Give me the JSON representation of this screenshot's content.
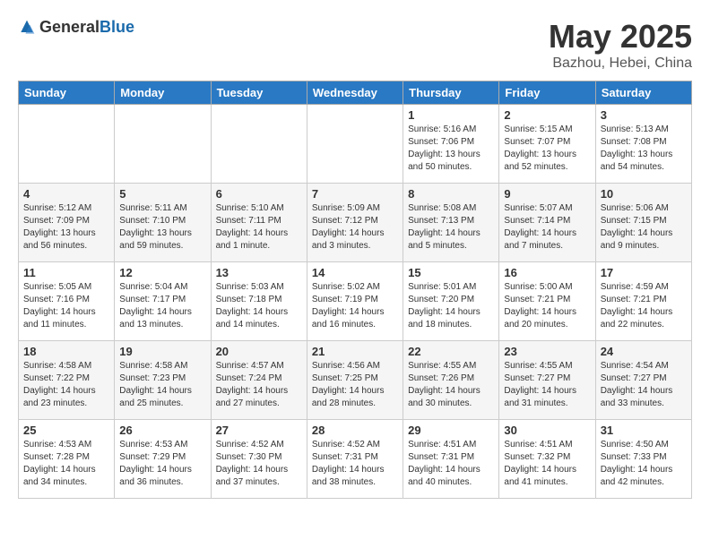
{
  "header": {
    "logo_general": "General",
    "logo_blue": "Blue",
    "month": "May 2025",
    "location": "Bazhou, Hebei, China"
  },
  "days_of_week": [
    "Sunday",
    "Monday",
    "Tuesday",
    "Wednesday",
    "Thursday",
    "Friday",
    "Saturday"
  ],
  "weeks": [
    [
      {
        "day": "",
        "info": ""
      },
      {
        "day": "",
        "info": ""
      },
      {
        "day": "",
        "info": ""
      },
      {
        "day": "",
        "info": ""
      },
      {
        "day": "1",
        "info": "Sunrise: 5:16 AM\nSunset: 7:06 PM\nDaylight: 13 hours\nand 50 minutes."
      },
      {
        "day": "2",
        "info": "Sunrise: 5:15 AM\nSunset: 7:07 PM\nDaylight: 13 hours\nand 52 minutes."
      },
      {
        "day": "3",
        "info": "Sunrise: 5:13 AM\nSunset: 7:08 PM\nDaylight: 13 hours\nand 54 minutes."
      }
    ],
    [
      {
        "day": "4",
        "info": "Sunrise: 5:12 AM\nSunset: 7:09 PM\nDaylight: 13 hours\nand 56 minutes."
      },
      {
        "day": "5",
        "info": "Sunrise: 5:11 AM\nSunset: 7:10 PM\nDaylight: 13 hours\nand 59 minutes."
      },
      {
        "day": "6",
        "info": "Sunrise: 5:10 AM\nSunset: 7:11 PM\nDaylight: 14 hours\nand 1 minute."
      },
      {
        "day": "7",
        "info": "Sunrise: 5:09 AM\nSunset: 7:12 PM\nDaylight: 14 hours\nand 3 minutes."
      },
      {
        "day": "8",
        "info": "Sunrise: 5:08 AM\nSunset: 7:13 PM\nDaylight: 14 hours\nand 5 minutes."
      },
      {
        "day": "9",
        "info": "Sunrise: 5:07 AM\nSunset: 7:14 PM\nDaylight: 14 hours\nand 7 minutes."
      },
      {
        "day": "10",
        "info": "Sunrise: 5:06 AM\nSunset: 7:15 PM\nDaylight: 14 hours\nand 9 minutes."
      }
    ],
    [
      {
        "day": "11",
        "info": "Sunrise: 5:05 AM\nSunset: 7:16 PM\nDaylight: 14 hours\nand 11 minutes."
      },
      {
        "day": "12",
        "info": "Sunrise: 5:04 AM\nSunset: 7:17 PM\nDaylight: 14 hours\nand 13 minutes."
      },
      {
        "day": "13",
        "info": "Sunrise: 5:03 AM\nSunset: 7:18 PM\nDaylight: 14 hours\nand 14 minutes."
      },
      {
        "day": "14",
        "info": "Sunrise: 5:02 AM\nSunset: 7:19 PM\nDaylight: 14 hours\nand 16 minutes."
      },
      {
        "day": "15",
        "info": "Sunrise: 5:01 AM\nSunset: 7:20 PM\nDaylight: 14 hours\nand 18 minutes."
      },
      {
        "day": "16",
        "info": "Sunrise: 5:00 AM\nSunset: 7:21 PM\nDaylight: 14 hours\nand 20 minutes."
      },
      {
        "day": "17",
        "info": "Sunrise: 4:59 AM\nSunset: 7:21 PM\nDaylight: 14 hours\nand 22 minutes."
      }
    ],
    [
      {
        "day": "18",
        "info": "Sunrise: 4:58 AM\nSunset: 7:22 PM\nDaylight: 14 hours\nand 23 minutes."
      },
      {
        "day": "19",
        "info": "Sunrise: 4:58 AM\nSunset: 7:23 PM\nDaylight: 14 hours\nand 25 minutes."
      },
      {
        "day": "20",
        "info": "Sunrise: 4:57 AM\nSunset: 7:24 PM\nDaylight: 14 hours\nand 27 minutes."
      },
      {
        "day": "21",
        "info": "Sunrise: 4:56 AM\nSunset: 7:25 PM\nDaylight: 14 hours\nand 28 minutes."
      },
      {
        "day": "22",
        "info": "Sunrise: 4:55 AM\nSunset: 7:26 PM\nDaylight: 14 hours\nand 30 minutes."
      },
      {
        "day": "23",
        "info": "Sunrise: 4:55 AM\nSunset: 7:27 PM\nDaylight: 14 hours\nand 31 minutes."
      },
      {
        "day": "24",
        "info": "Sunrise: 4:54 AM\nSunset: 7:27 PM\nDaylight: 14 hours\nand 33 minutes."
      }
    ],
    [
      {
        "day": "25",
        "info": "Sunrise: 4:53 AM\nSunset: 7:28 PM\nDaylight: 14 hours\nand 34 minutes."
      },
      {
        "day": "26",
        "info": "Sunrise: 4:53 AM\nSunset: 7:29 PM\nDaylight: 14 hours\nand 36 minutes."
      },
      {
        "day": "27",
        "info": "Sunrise: 4:52 AM\nSunset: 7:30 PM\nDaylight: 14 hours\nand 37 minutes."
      },
      {
        "day": "28",
        "info": "Sunrise: 4:52 AM\nSunset: 7:31 PM\nDaylight: 14 hours\nand 38 minutes."
      },
      {
        "day": "29",
        "info": "Sunrise: 4:51 AM\nSunset: 7:31 PM\nDaylight: 14 hours\nand 40 minutes."
      },
      {
        "day": "30",
        "info": "Sunrise: 4:51 AM\nSunset: 7:32 PM\nDaylight: 14 hours\nand 41 minutes."
      },
      {
        "day": "31",
        "info": "Sunrise: 4:50 AM\nSunset: 7:33 PM\nDaylight: 14 hours\nand 42 minutes."
      }
    ]
  ]
}
